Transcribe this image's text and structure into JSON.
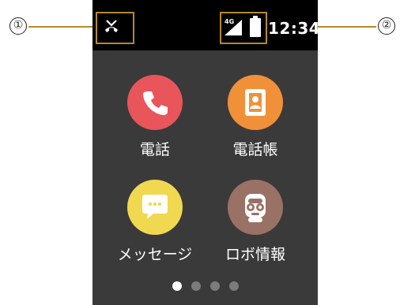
{
  "callouts": [
    {
      "number": "①",
      "target": "status-left-area"
    },
    {
      "number": "②",
      "target": "status-right-area"
    }
  ],
  "statusbar": {
    "time": "12:34",
    "network": "4G",
    "left_icon": "missed-call-icon",
    "right_icons": [
      "signal-icon",
      "battery-icon"
    ]
  },
  "apps": [
    {
      "label": "電話",
      "icon": "phone-icon",
      "color": "#e8555b"
    },
    {
      "label": "電話帳",
      "icon": "contacts-book-icon",
      "color": "#f0913a"
    },
    {
      "label": "メッセージ",
      "icon": "message-icon",
      "color": "#f1d851"
    },
    {
      "label": "ロボ情報",
      "icon": "robot-face-icon",
      "color": "#9a7165"
    }
  ],
  "pager": {
    "pages": 4,
    "current": 1
  }
}
